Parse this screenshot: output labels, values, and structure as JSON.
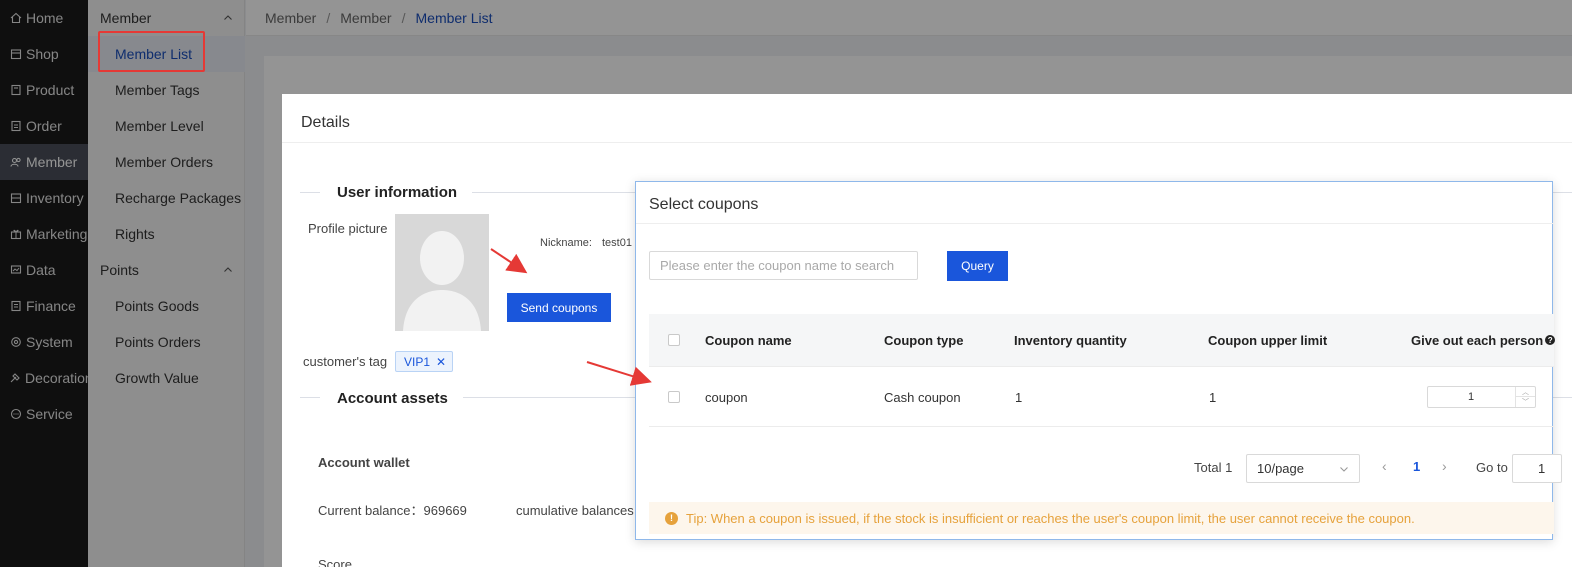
{
  "nav": {
    "items": [
      {
        "label": "Home",
        "icon": "home-icon"
      },
      {
        "label": "Shop",
        "icon": "shop-icon"
      },
      {
        "label": "Product",
        "icon": "product-icon"
      },
      {
        "label": "Order",
        "icon": "order-icon"
      },
      {
        "label": "Member",
        "icon": "member-icon",
        "active": true
      },
      {
        "label": "Inventory",
        "icon": "inventory-icon"
      },
      {
        "label": "Marketing",
        "icon": "marketing-icon"
      },
      {
        "label": "Data",
        "icon": "data-icon"
      },
      {
        "label": "Finance",
        "icon": "finance-icon"
      },
      {
        "label": "System",
        "icon": "gear-icon"
      },
      {
        "label": "Decoration",
        "icon": "decoration-icon"
      },
      {
        "label": "Service",
        "icon": "chat-icon"
      }
    ]
  },
  "subnav": {
    "group_member": "Member",
    "member_items": [
      "Member List",
      "Member Tags",
      "Member Level",
      "Member Orders",
      "Recharge Packages",
      "Rights"
    ],
    "group_points": "Points",
    "points_items": [
      "Points Goods",
      "Points Orders",
      "Growth Value"
    ]
  },
  "breadcrumb": {
    "items": [
      "Member",
      "Member",
      "Member List"
    ]
  },
  "details": {
    "title": "Details",
    "user_info_title": "User information",
    "profile_picture_label": "Profile picture",
    "nickname_label": "Nickname:",
    "nickname_value": "test01",
    "send_coupons_label": "Send coupons",
    "customer_tag_label": "customer's tag",
    "tag_value": "VIP1",
    "account_assets_title": "Account assets",
    "wallet_label": "Account wallet",
    "current_balance_label": "Current balance：",
    "current_balance_value": "969669",
    "cumulative_label": "cumulative balances：",
    "score_label": "Score"
  },
  "coupons": {
    "title": "Select coupons",
    "search_placeholder": "Please enter the coupon name to search",
    "query_label": "Query",
    "columns": [
      "Coupon name",
      "Coupon type",
      "Inventory quantity",
      "Coupon upper limit",
      "Give out each person"
    ],
    "rows": [
      {
        "name": "coupon",
        "type": "Cash coupon",
        "inventory": "1",
        "limit": "1",
        "each": "1"
      }
    ],
    "pager": {
      "total": "Total 1",
      "page_size": "10/page",
      "current_page": "1",
      "goto_label": "Go to",
      "goto_value": "1"
    },
    "tip": "Tip: When a coupon is issued, if the stock is insufficient or reaches the user's coupon limit, the user cannot receive the coupon."
  },
  "colors": {
    "primary": "#1a56db",
    "nav_bg": "#1b1b1b",
    "annotation": "#e53935",
    "tip_text": "#e6a23c"
  }
}
